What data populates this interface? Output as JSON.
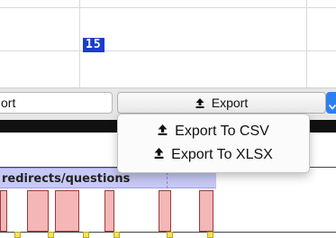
{
  "grid": {
    "cell_value": "15"
  },
  "toolbar": {
    "sort_input_value": "ort",
    "export_label": "Export"
  },
  "timeline": {
    "lane_label": "redirects/questions"
  },
  "export_menu": {
    "items": [
      {
        "label": "Export To CSV",
        "icon": "upload-icon"
      },
      {
        "label": "Export To XLSX",
        "icon": "upload-icon"
      }
    ]
  },
  "colors": {
    "accent_blue": "#2d7ff0",
    "badge_blue": "#1a3fc7",
    "lane_fill": "#c7c9f5",
    "bar_fill": "#f4b6b6",
    "marker_fill": "#f2e55a"
  }
}
